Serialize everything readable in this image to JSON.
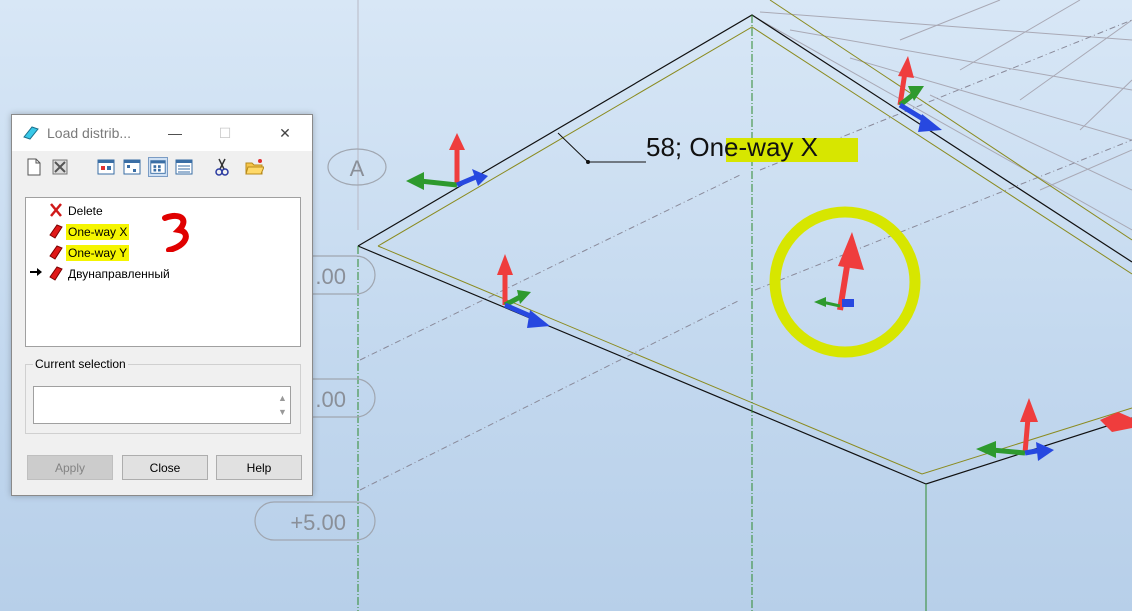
{
  "viewport": {
    "axis_label": "A",
    "level_labels": [
      ".00",
      ".00",
      "+5.00"
    ],
    "annotation": {
      "prefix": "58; ",
      "highlight": "One-way X"
    }
  },
  "dialog": {
    "title": "Load distrib...",
    "title_buttons": {
      "minimize": "—",
      "maximize": "☐",
      "close": "✕"
    },
    "toolbar_icons": [
      "new-icon",
      "delete-icon",
      "view-1-icon",
      "view-2-icon",
      "view-3-icon",
      "view-4-icon",
      "scissors-icon",
      "folder-icon"
    ],
    "list": [
      {
        "label": "Delete",
        "icon": "delete-x-icon",
        "highlight": false,
        "current": false
      },
      {
        "label": "One-way X",
        "icon": "load-icon",
        "highlight": true,
        "current": false
      },
      {
        "label": "One-way Y",
        "icon": "load-icon",
        "highlight": true,
        "current": false
      },
      {
        "label": "Двунаправленный",
        "icon": "load-icon",
        "highlight": false,
        "current": true
      }
    ],
    "current_selection": {
      "label": "Current selection",
      "value": ""
    },
    "buttons": {
      "apply": "Apply",
      "close": "Close",
      "help": "Help"
    },
    "apply_enabled": false
  },
  "colors": {
    "highlight_yellow": "#f5f500",
    "annotation_yellow": "#d7e600",
    "axis_red": "#ef3d3d",
    "axis_green": "#2e9a2e",
    "axis_blue": "#2748e0",
    "scribble_red": "#e00000"
  }
}
